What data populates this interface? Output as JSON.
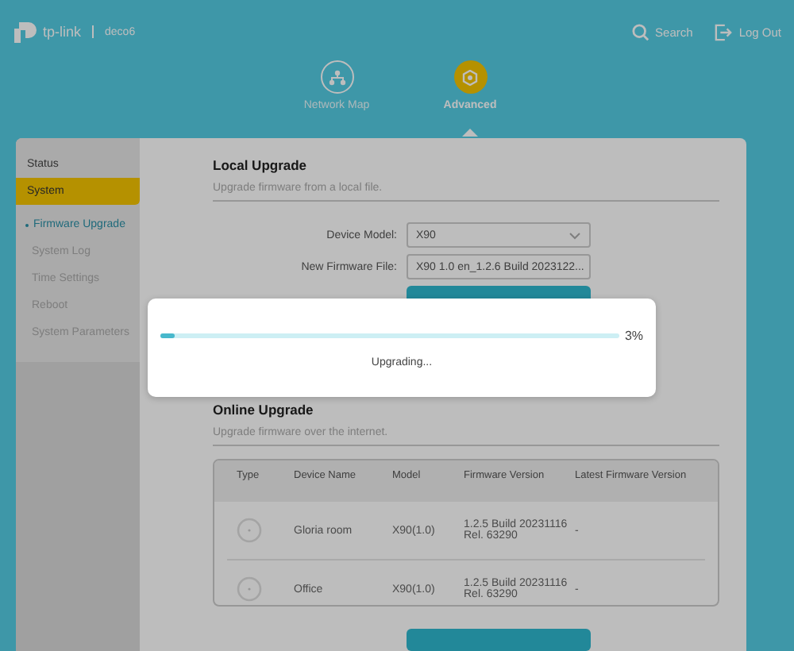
{
  "header": {
    "brand": "tp-link",
    "device": "deco6",
    "actions": [
      {
        "kind": "search",
        "label": "Search"
      },
      {
        "kind": "logout",
        "label": "Log Out"
      }
    ]
  },
  "nav": [
    {
      "kind": "map",
      "label": "Network Map",
      "selected": false
    },
    {
      "kind": "gear",
      "label": "Advanced",
      "selected": true
    }
  ],
  "sidebar": {
    "items": [
      {
        "label": "Status",
        "selected": false
      },
      {
        "label": "System",
        "selected": true
      }
    ],
    "sub_items": [
      {
        "label": "Firmware Upgrade",
        "selected": true
      },
      {
        "label": "System Log",
        "selected": false
      },
      {
        "label": "Time Settings",
        "selected": false
      },
      {
        "label": "Reboot",
        "selected": false
      },
      {
        "label": "System Parameters",
        "selected": false
      }
    ]
  },
  "local_upgrade": {
    "title": "Local Upgrade",
    "subtitle": "Upgrade firmware from a local file.",
    "fields": [
      {
        "kind": "select",
        "label": "Device Model:",
        "value": "X90"
      },
      {
        "kind": "file",
        "label": "New Firmware File:",
        "value": "X90 1.0 en_1.2.6 Build 2023122..."
      }
    ]
  },
  "online_upgrade": {
    "title": "Online Upgrade",
    "subtitle": "Upgrade firmware over the internet.",
    "table": {
      "columns": [
        "Type",
        "Device Name",
        "Model",
        "Firmware Version",
        "Latest Firmware Version"
      ],
      "rows": [
        [
          "",
          "Gloria room",
          "X90(1.0)",
          "1.2.5 Build 20231116 Rel. 63290",
          "-"
        ],
        [
          "",
          "Office",
          "X90(1.0)",
          "1.2.5 Build 20231116 Rel. 63290",
          "-"
        ]
      ]
    }
  },
  "dialog": {
    "level": 0.03,
    "percent": "3%",
    "message": "Upgrading..."
  }
}
